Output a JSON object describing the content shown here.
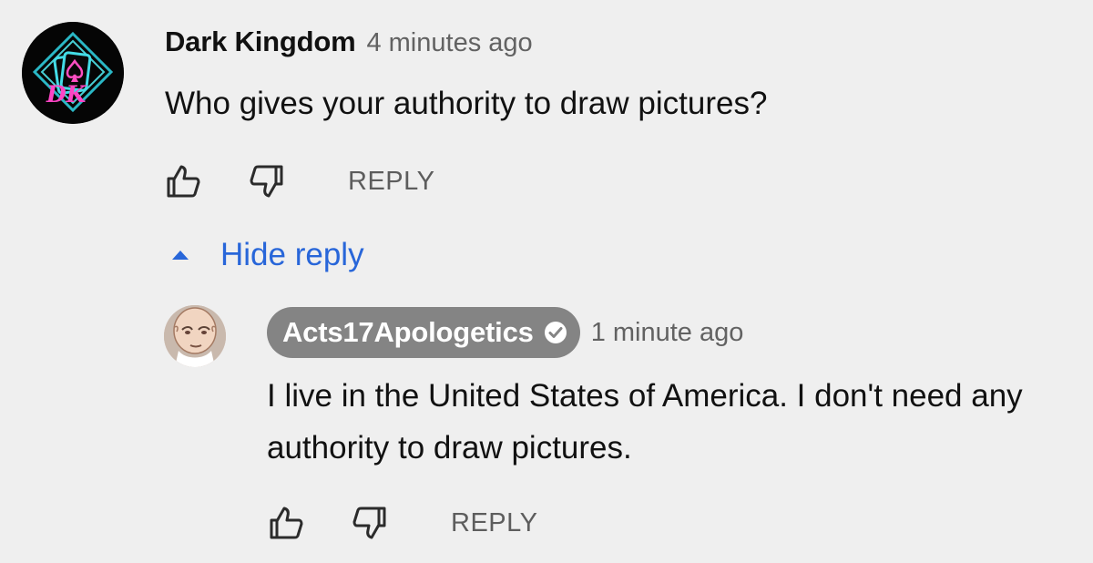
{
  "main_comment": {
    "author": "Dark Kingdom",
    "timestamp": "4 minutes ago",
    "text": "Who gives your authority to draw pictures?",
    "avatar_icon": "dark-kingdom-logo-avatar",
    "reply_label": "REPLY",
    "like_icon": "thumb-up-icon",
    "dislike_icon": "thumb-down-icon",
    "avatar_logo_text": "DK"
  },
  "thread": {
    "hide_reply_label": "Hide reply",
    "hide_icon": "triangle-up-icon",
    "accent_color": "#2866d9"
  },
  "reply_comment": {
    "author": "Acts17Apologetics",
    "verified_icon": "verified-check-icon",
    "timestamp": "1 minute ago",
    "text": "I live in the United States of America. I don't need any authority to draw pictures.",
    "reply_label": "REPLY",
    "avatar_icon": "bald-cartoon-avatar",
    "like_icon": "thumb-up-icon",
    "dislike_icon": "thumb-down-icon"
  },
  "colors": {
    "background": "#efefef",
    "author_pill": "#848484",
    "secondary_text": "#626262",
    "primary_text": "#111111"
  }
}
